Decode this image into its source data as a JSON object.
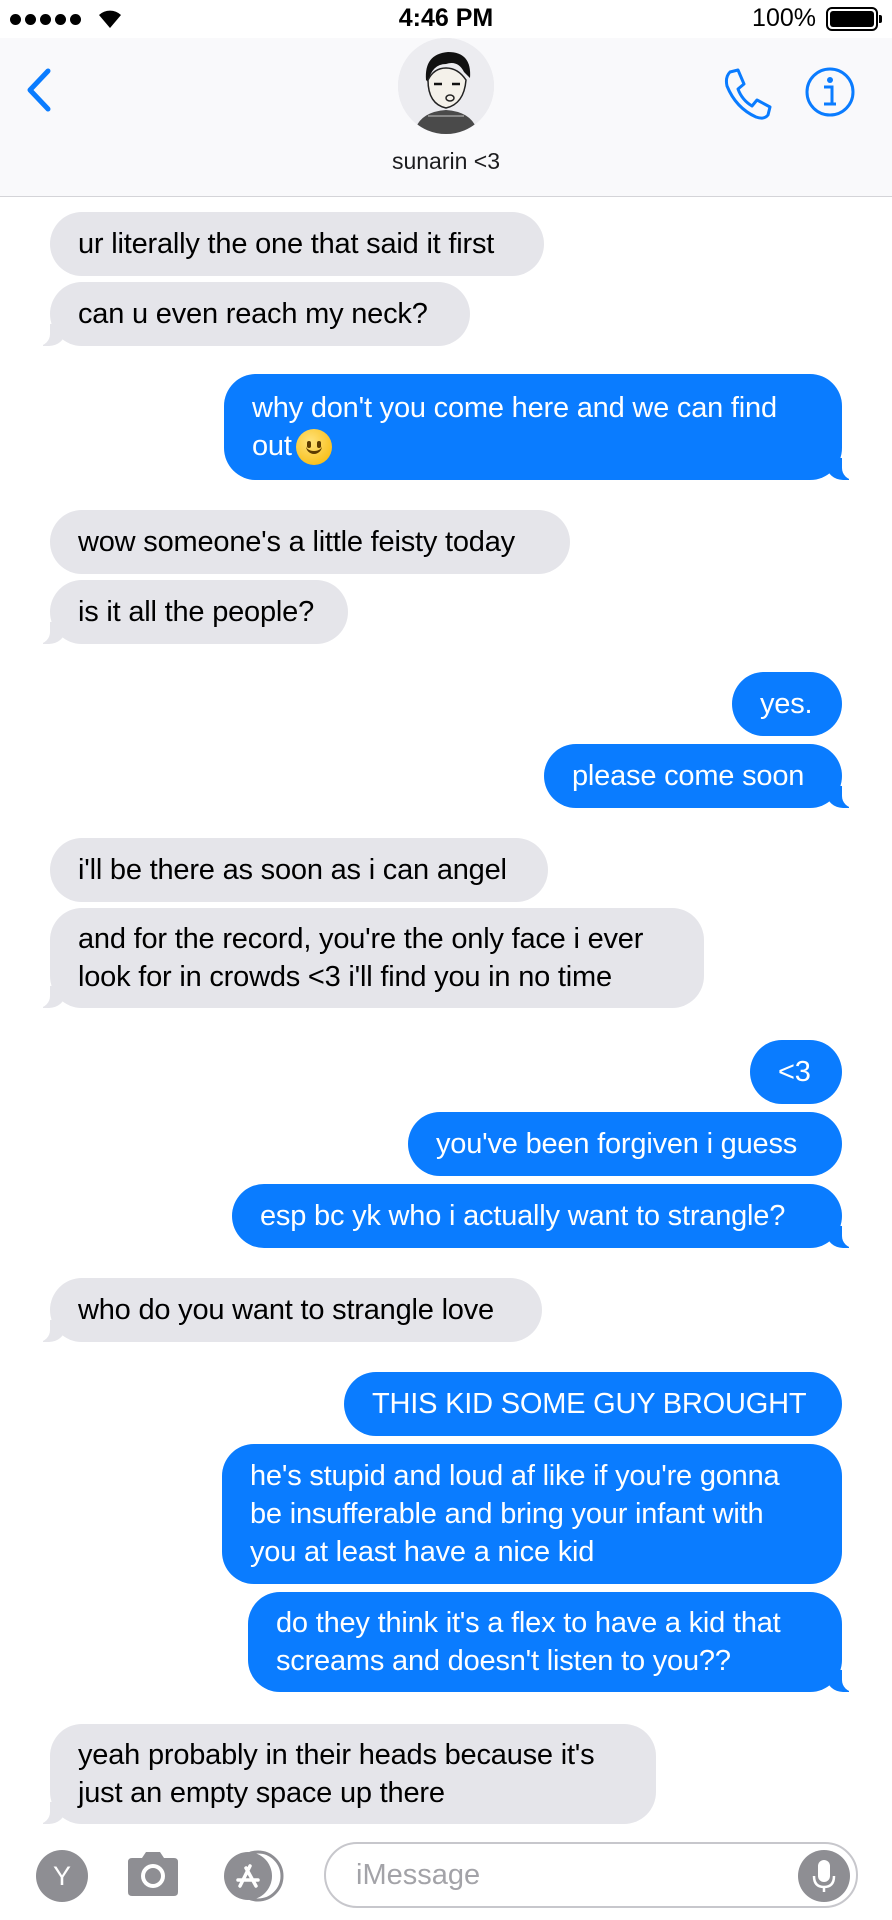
{
  "status_bar": {
    "time": "4:46 PM",
    "battery_percent_label": "100%",
    "battery_level": 1.0,
    "signal_bars": 5,
    "icons": [
      "signal-dots-icon",
      "wifi-icon",
      "battery-icon"
    ]
  },
  "header": {
    "contact_name": "sunarin <3",
    "back_icon": "chevron-left-icon",
    "call_icon": "phone-icon",
    "info_icon": "info-icon"
  },
  "colors": {
    "accent": "#0a7cff",
    "incoming_bubble": "#e5e5ea",
    "outgoing_bubble": "#0a7cff",
    "placeholder": "#a3a3a8"
  },
  "messages": [
    {
      "dir": "in",
      "text": "ur literally the one that said it first"
    },
    {
      "dir": "in",
      "text": "can u even reach my neck?"
    },
    {
      "dir": "out",
      "text": "why don't you come here and we can find\nout",
      "emoji": "slightly-smiling-face"
    },
    {
      "dir": "in",
      "text": "wow someone's a little feisty today"
    },
    {
      "dir": "in",
      "text": "is it all the people?"
    },
    {
      "dir": "out",
      "text": "yes."
    },
    {
      "dir": "out",
      "text": "please come soon"
    },
    {
      "dir": "in",
      "text": "i'll be there as soon as i can angel"
    },
    {
      "dir": "in",
      "text": "and for the record, you're the only face i ever\nlook for in crowds <3 i'll find you in no time"
    },
    {
      "dir": "out",
      "text": "<3"
    },
    {
      "dir": "out",
      "text": "you've been forgiven i guess"
    },
    {
      "dir": "out",
      "text": "esp bc yk who i actually want to strangle?"
    },
    {
      "dir": "in",
      "text": "who do you want to strangle love"
    },
    {
      "dir": "out",
      "text": "THIS KID SOME GUY BROUGHT"
    },
    {
      "dir": "out",
      "text": "he's stupid and loud af like if you're gonna\nbe insufferable and bring your infant with\nyou at least have a nice kid"
    },
    {
      "dir": "out",
      "text": "do they think it's a flex to have a kid that\nscreams and doesn't listen to you??"
    },
    {
      "dir": "in",
      "text": "yeah probably in their heads because it's\njust an empty space up there"
    }
  ],
  "input_bar": {
    "app_y_label": "Y",
    "placeholder": "iMessage",
    "icons": [
      "y-app-icon",
      "camera-icon",
      "app-store-icon",
      "microphone-icon"
    ]
  }
}
